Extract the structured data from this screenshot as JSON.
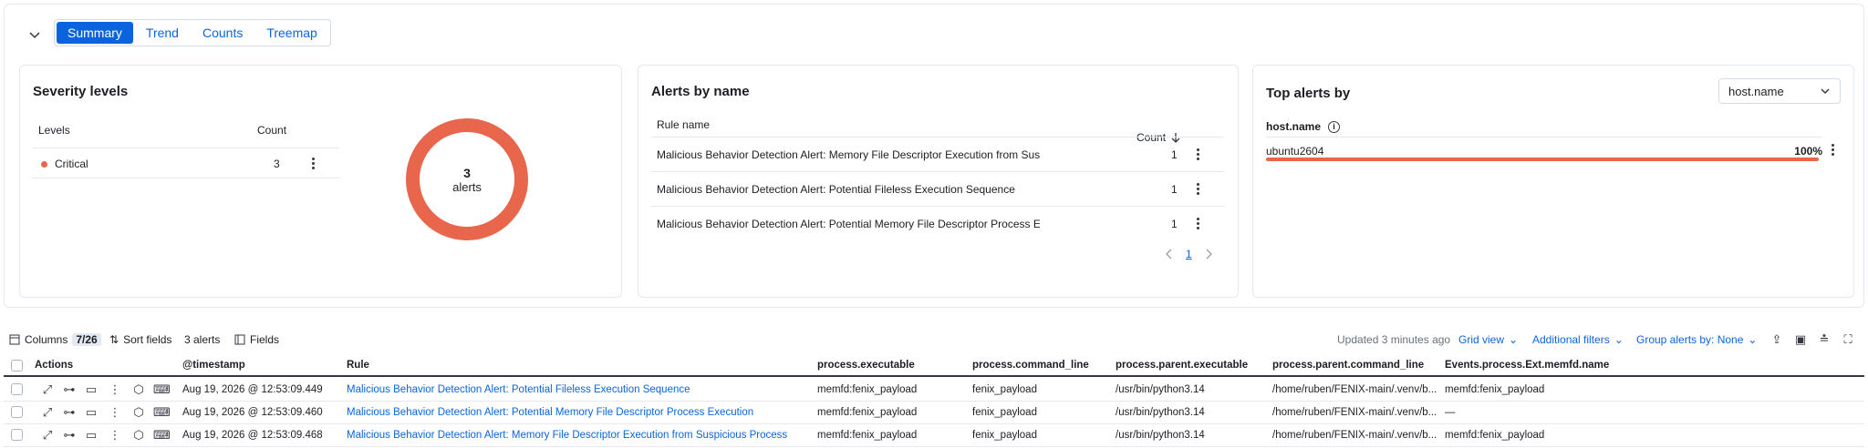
{
  "tabs": [
    {
      "label": "Summary",
      "active": true
    },
    {
      "label": "Trend"
    },
    {
      "label": "Counts"
    },
    {
      "label": "Treemap"
    }
  ],
  "severity": {
    "title": "Severity levels",
    "col_levels": "Levels",
    "col_count": "Count",
    "rows": [
      {
        "label": "Critical",
        "count": "3",
        "color": "#e7664c"
      }
    ],
    "donut_value": "3",
    "donut_label": "alerts"
  },
  "alerts_by_name": {
    "title": "Alerts by name",
    "col_rule": "Rule name",
    "col_count": "Count",
    "rows": [
      {
        "name": "Malicious Behavior Detection Alert: Memory File Descriptor Execution from Sus...",
        "count": "1"
      },
      {
        "name": "Malicious Behavior Detection Alert: Potential Fileless Execution Sequence",
        "count": "1"
      },
      {
        "name": "Malicious Behavior Detection Alert: Potential Memory File Descriptor Process E...",
        "count": "1"
      }
    ],
    "page": "1"
  },
  "top_alerts": {
    "title": "Top alerts by",
    "select_value": "host.name",
    "field_label": "host.name",
    "rows": [
      {
        "host": "ubuntu2604",
        "percent": "100%",
        "fraction": 1.0
      }
    ]
  },
  "toolbar": {
    "columns_label": "Columns",
    "columns_count": "7/26",
    "sort_label": "Sort fields",
    "alerts_count": "3 alerts",
    "fields_label": "Fields",
    "updated": "Updated 3 minutes ago",
    "grid_view": "Grid view",
    "additional_filters": "Additional filters",
    "group_by": "Group alerts by: None"
  },
  "table": {
    "headers": {
      "actions": "Actions",
      "timestamp": "@timestamp",
      "rule": "Rule",
      "exe": "process.executable",
      "cmd": "process.command_line",
      "pexe": "process.parent.executable",
      "pcmd": "process.parent.command_line",
      "memfd": "Events.process.Ext.memfd.name"
    },
    "rows": [
      {
        "timestamp": "Aug 19, 2026 @ 12:53:09.449",
        "rule": "Malicious Behavior Detection Alert: Potential Fileless Execution Sequence",
        "exe": "memfd:fenix_payload",
        "cmd": "fenix_payload",
        "pexe": "/usr/bin/python3.14",
        "pcmd": "/home/ruben/FENIX-main/.venv/b...",
        "memfd": "memfd:fenix_payload"
      },
      {
        "timestamp": "Aug 19, 2026 @ 12:53:09.460",
        "rule": "Malicious Behavior Detection Alert: Potential Memory File Descriptor Process Execution",
        "exe": "memfd:fenix_payload",
        "cmd": "fenix_payload",
        "pexe": "/usr/bin/python3.14",
        "pcmd": "/home/ruben/FENIX-main/.venv/b...",
        "memfd": "—"
      },
      {
        "timestamp": "Aug 19, 2026 @ 12:53:09.468",
        "rule": "Malicious Behavior Detection Alert: Memory File Descriptor Execution from Suspicious Process",
        "exe": "memfd:fenix_payload",
        "cmd": "fenix_payload",
        "pexe": "/usr/bin/python3.14",
        "pcmd": "/home/ruben/FENIX-main/.venv/b...",
        "memfd": "memfd:fenix_payload"
      }
    ]
  }
}
